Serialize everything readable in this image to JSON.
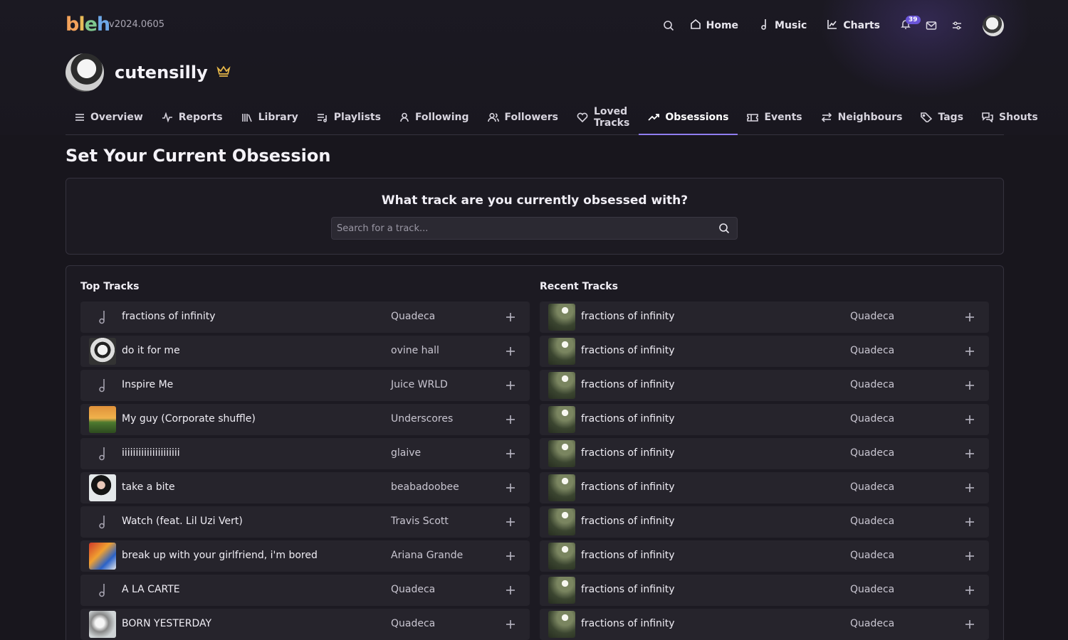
{
  "app": {
    "logo_letters": [
      "b",
      "l",
      "e",
      "h"
    ],
    "version": "v2024.0605"
  },
  "nav": {
    "home": "Home",
    "music": "Music",
    "charts": "Charts",
    "notification_count": "39"
  },
  "profile": {
    "username": "cutensilly"
  },
  "tabs": [
    {
      "label": "Overview",
      "icon": "menu-icon"
    },
    {
      "label": "Reports",
      "icon": "activity-icon"
    },
    {
      "label": "Library",
      "icon": "library-icon"
    },
    {
      "label": "Playlists",
      "icon": "playlist-icon"
    },
    {
      "label": "Following",
      "icon": "user-icon"
    },
    {
      "label": "Followers",
      "icon": "users-icon"
    },
    {
      "label": "Loved Tracks",
      "icon": "heart-icon"
    },
    {
      "label": "Obsessions",
      "icon": "trending-up-icon",
      "active": true
    },
    {
      "label": "Events",
      "icon": "ticket-icon"
    },
    {
      "label": "Neighbours",
      "icon": "swap-icon"
    },
    {
      "label": "Tags",
      "icon": "tag-icon"
    },
    {
      "label": "Shouts",
      "icon": "messages-icon"
    }
  ],
  "page": {
    "title": "Set Your Current Obsession",
    "question": "What track are you currently obsessed with?",
    "search_placeholder": "Search for a track..."
  },
  "top_tracks": {
    "heading": "Top Tracks",
    "items": [
      {
        "title": "fractions of infinity",
        "artist": "Quadeca",
        "art": "none"
      },
      {
        "title": "do it for me",
        "artist": "ovine hall",
        "art": "a1"
      },
      {
        "title": "Inspire Me",
        "artist": "Juice WRLD",
        "art": "none"
      },
      {
        "title": "My guy (Corporate shuffle)",
        "artist": "Underscores",
        "art": "a2"
      },
      {
        "title": "iiiiiiiiiiiiiiiiiiiii",
        "artist": "glaive",
        "art": "none"
      },
      {
        "title": "take a bite",
        "artist": "beabadoobee",
        "art": "a3"
      },
      {
        "title": "Watch (feat. Lil Uzi Vert)",
        "artist": "Travis Scott",
        "art": "none"
      },
      {
        "title": "break up with your girlfriend, i'm bored",
        "artist": "Ariana Grande",
        "art": "a4"
      },
      {
        "title": "A LA CARTE",
        "artist": "Quadeca",
        "art": "none"
      },
      {
        "title": "BORN YESTERDAY",
        "artist": "Quadeca",
        "art": "a5"
      }
    ]
  },
  "recent_tracks": {
    "heading": "Recent Tracks",
    "items": [
      {
        "title": "fractions of infinity",
        "artist": "Quadeca"
      },
      {
        "title": "fractions of infinity",
        "artist": "Quadeca"
      },
      {
        "title": "fractions of infinity",
        "artist": "Quadeca"
      },
      {
        "title": "fractions of infinity",
        "artist": "Quadeca"
      },
      {
        "title": "fractions of infinity",
        "artist": "Quadeca"
      },
      {
        "title": "fractions of infinity",
        "artist": "Quadeca"
      },
      {
        "title": "fractions of infinity",
        "artist": "Quadeca"
      },
      {
        "title": "fractions of infinity",
        "artist": "Quadeca"
      },
      {
        "title": "fractions of infinity",
        "artist": "Quadeca"
      },
      {
        "title": "fractions of infinity",
        "artist": "Quadeca"
      }
    ]
  },
  "colors": {
    "background": "#18161d",
    "accent": "#8f7df0",
    "badge": "#6a55d8",
    "crown": "#e9b949"
  }
}
